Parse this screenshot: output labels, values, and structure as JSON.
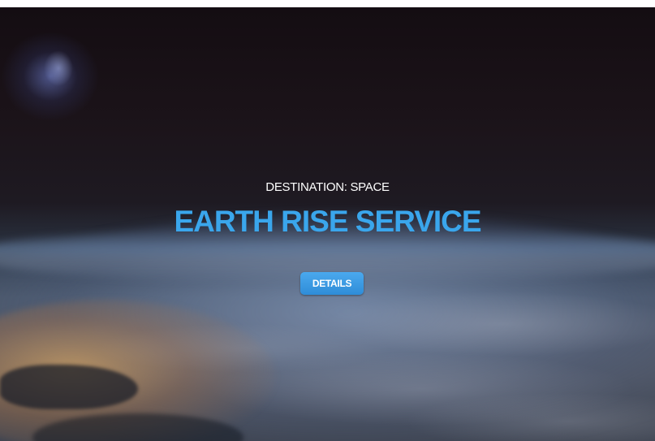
{
  "hero": {
    "subtitle": "DESTINATION: SPACE",
    "title": "EARTH RISE SERVICE",
    "details_button_label": "DETAILS"
  },
  "colors": {
    "title": "#3aa6ec",
    "button": "#3a9be3",
    "subtitle": "#ffffff"
  }
}
